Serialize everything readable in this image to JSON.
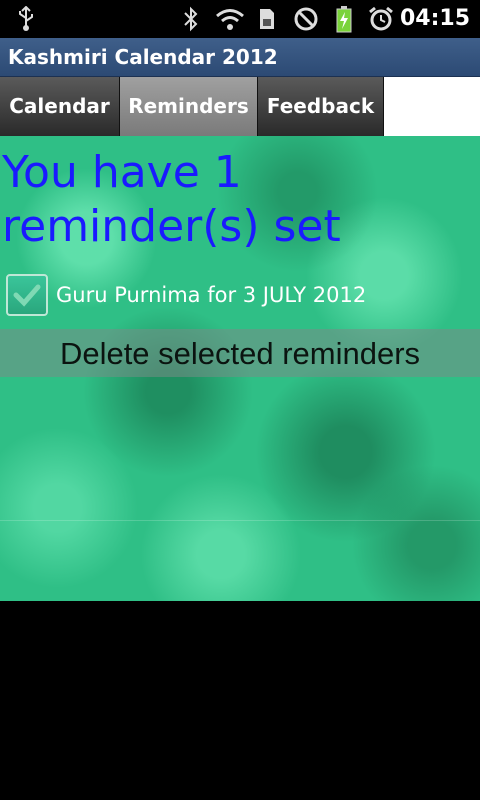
{
  "status_bar": {
    "time": "04:15",
    "icons": [
      "usb-icon",
      "bluetooth-icon",
      "wifi-icon",
      "sim-icon",
      "no-signal-icon",
      "battery-charging-icon",
      "alarm-icon"
    ]
  },
  "app": {
    "title": "Kashmiri Calendar 2012"
  },
  "tabs": [
    {
      "label": "Calendar",
      "selected": false
    },
    {
      "label": "Reminders",
      "selected": true
    },
    {
      "label": "Feedback",
      "selected": false
    }
  ],
  "reminders": {
    "heading": "You have 1 reminder(s) set",
    "items": [
      {
        "label": "Guru Purnima for 3 JULY 2012",
        "checked": true
      }
    ],
    "delete_label": "Delete selected reminders"
  },
  "colors": {
    "heading_text": "#1a1aff",
    "background_green": "#2fbf86"
  }
}
